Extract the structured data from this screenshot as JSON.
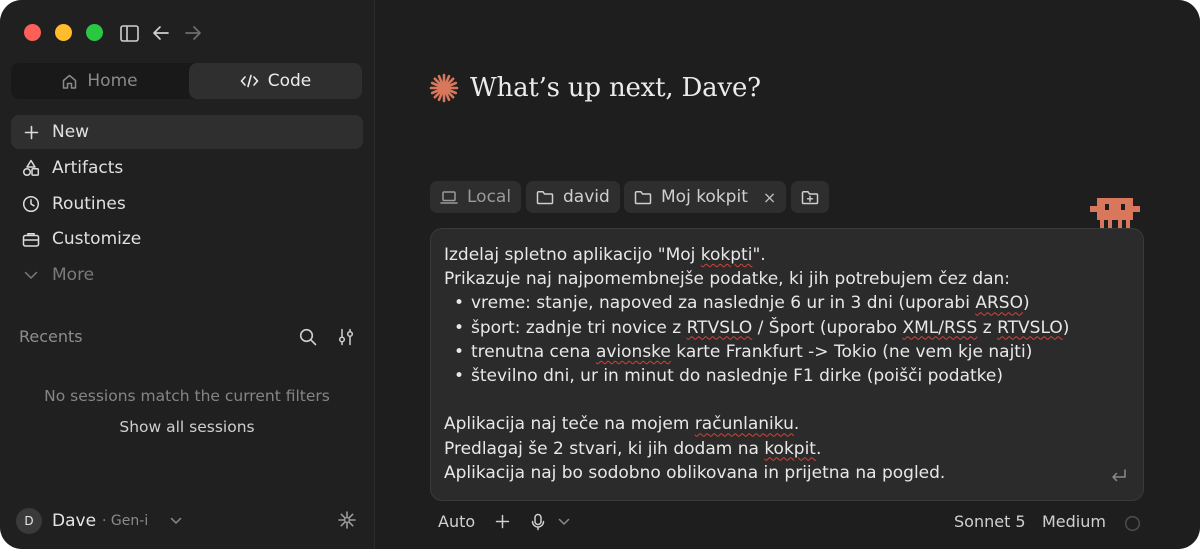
{
  "sidebar": {
    "segment": {
      "home_label": "Home",
      "code_label": "Code"
    },
    "nav": {
      "new_label": "New",
      "artifacts_label": "Artifacts",
      "routines_label": "Routines",
      "customize_label": "Customize",
      "more_label": "More"
    },
    "recents": {
      "label": "Recents",
      "empty_message": "No sessions match the current filters",
      "show_all_label": "Show all sessions"
    },
    "user": {
      "initial": "D",
      "name": "Dave",
      "plan": "· Gen-i"
    }
  },
  "main": {
    "greeting": "What’s up next, Dave?",
    "chips": {
      "local_label": "Local",
      "folder1_label": "david",
      "folder2_label": "Moj kokpit",
      "remove_glyph": "×"
    },
    "prompt": {
      "line1a": "Izdelaj spletno aplikacijo \"Moj ",
      "line1w": "kokpti",
      "line1b": "\".",
      "line2": "Prikazuje naj najpomembnejše podatke, ki jih potrebujem čez dan:",
      "b1a": "vreme: stanje, napoved za naslednje 6 ur in 3 dni (uporabi ",
      "b1w": "ARSO",
      "b1b": ")",
      "b2a": "šport: zadnje tri novice z ",
      "b2w1": "RTVSLO",
      "b2b": " / Šport (uporabo ",
      "b2w2": "XML/RSS",
      "b2c": " z ",
      "b2w3": "RTVSLO",
      "b2d": ")",
      "b3a": "trenutna cena ",
      "b3w": "avionske",
      "b3b": " karte Frankfurt -> Tokio (ne vem kje najti)",
      "b4": "številno dni, ur in minut do naslednje F1 dirke (poišči podatke)",
      "line7a": "Aplikacija naj teče na mojem ",
      "line7w": "računlaniku",
      "line7b": ".",
      "line8a": "Predlagaj še 2 stvari, ki jih dodam na ",
      "line8w": "kokpit",
      "line8b": ".",
      "line9": "Aplikacija naj bo sodobno oblikovana in prijetna na pogled."
    },
    "toolbar": {
      "mode_label": "Auto",
      "model_label": "Sonnet 5",
      "effort_label": "Medium"
    }
  },
  "colors": {
    "accent": "#d9775c",
    "traffic_red": "#fe5f57",
    "traffic_yellow": "#febc2e",
    "traffic_green": "#28c840",
    "mascot": "#d9775c"
  }
}
